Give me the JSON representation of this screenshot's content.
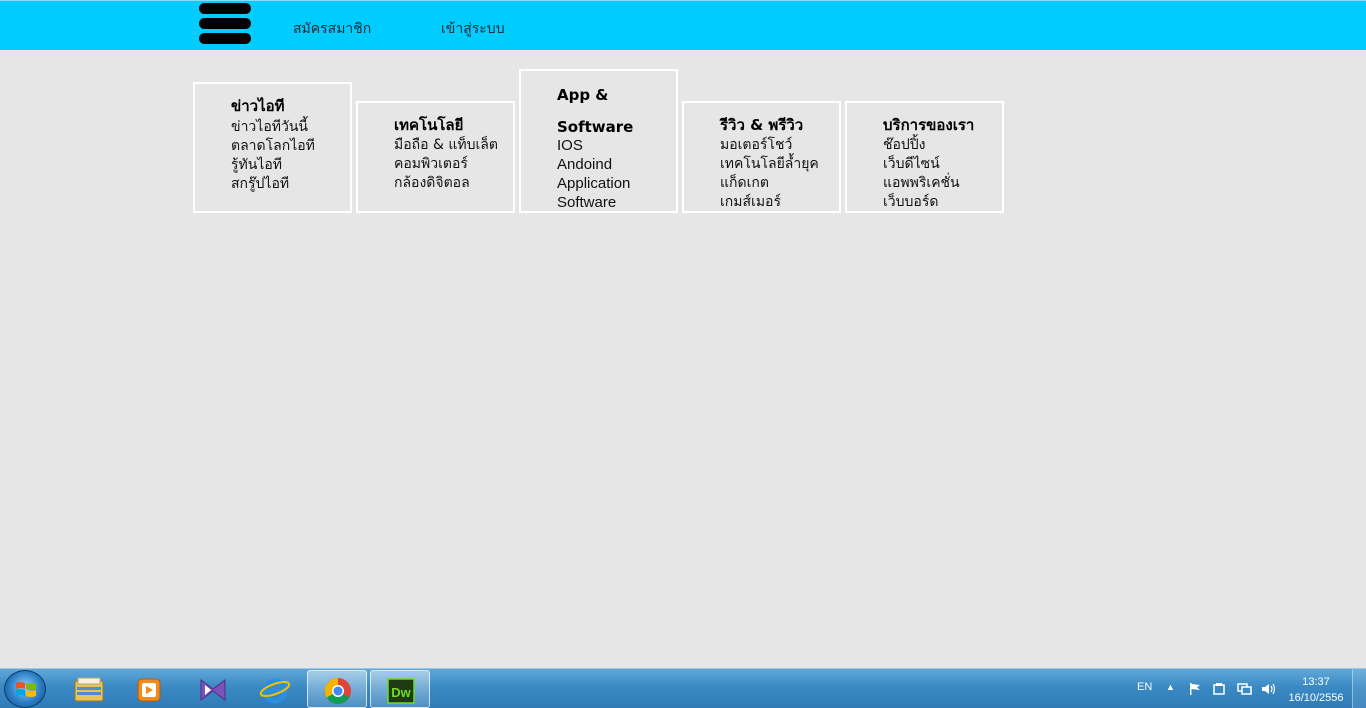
{
  "header": {
    "register_label": "สมัครสมาชิก",
    "login_label": "เข้าสู่ระบบ",
    "logo_icon": "stack-menu-icon",
    "background_color": "#00ccff"
  },
  "categories": [
    {
      "title": "ข่าวไอที",
      "items": [
        "ข่าวไอทีวันนี้",
        "ตลาดโลกไอที",
        "รู้ทันไอที",
        "สกรู๊ปไอที"
      ]
    },
    {
      "title": "เทคโนโลยี",
      "items": [
        "มือถือ & แท็บเล็ต",
        "คอมพิวเตอร์",
        "กล้องดิจิตอล"
      ]
    },
    {
      "title": "App & Software",
      "items": [
        "IOS",
        "Andoind",
        "Application",
        "Software"
      ]
    },
    {
      "title": "รีวิว & พรีวิว",
      "items": [
        "มอเตอร์โชว์",
        "เทคโนโลยีล้ำยุค",
        "แก็ดเกต",
        "เกมส์เมอร์"
      ]
    },
    {
      "title": "บริการของเรา",
      "items": [
        "ช๊อปปิ้ง",
        "เว็บดีไซน์",
        "แอพพริเคชั่น",
        "เว็บบอร์ด"
      ]
    }
  ],
  "taskbar": {
    "start_icon": "windows-start-icon",
    "apps": [
      {
        "name": "explorer-icon"
      },
      {
        "name": "media-player-icon"
      },
      {
        "name": "visual-studio-icon"
      },
      {
        "name": "internet-explorer-icon"
      },
      {
        "name": "chrome-icon"
      },
      {
        "name": "dreamweaver-icon",
        "label": "Dw"
      }
    ],
    "language": "EN",
    "time": "13:37",
    "date": "16/10/2556"
  }
}
